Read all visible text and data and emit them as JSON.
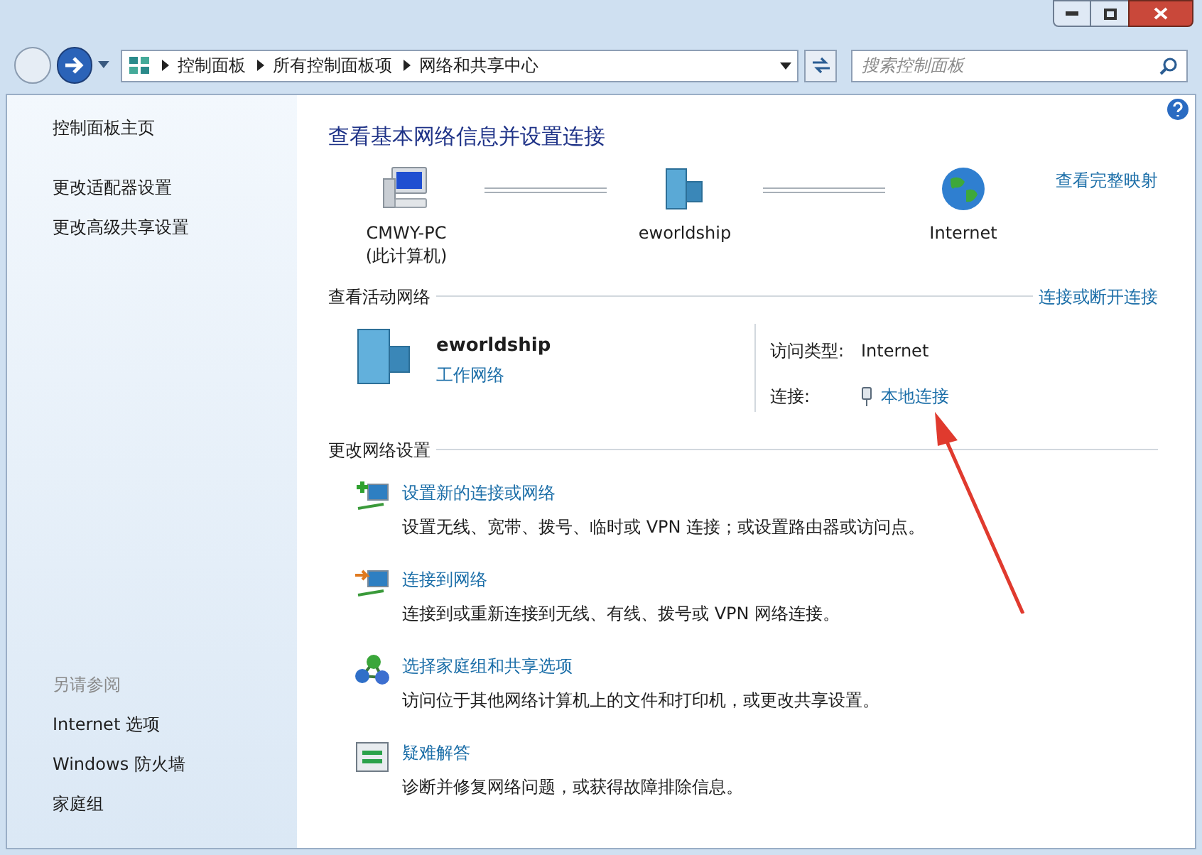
{
  "address_bar": {
    "breadcrumbs": [
      "控制面板",
      "所有控制面板项",
      "网络和共享中心"
    ]
  },
  "search": {
    "placeholder": "搜索控制面板"
  },
  "sidebar": {
    "items": [
      "控制面板主页",
      "更改适配器设置",
      "更改高级共享设置"
    ],
    "see_also_title": "另请参阅",
    "see_also": [
      "Internet 选项",
      "Windows 防火墙",
      "家庭组"
    ]
  },
  "main": {
    "title": "查看基本网络信息并设置连接",
    "full_map_link": "查看完整映射",
    "map_nodes": [
      {
        "kind": "computer",
        "label": "CMWY-PC",
        "sublabel": "(此计算机)"
      },
      {
        "kind": "network",
        "label": "eworldship"
      },
      {
        "kind": "internet",
        "label": "Internet"
      }
    ],
    "active_section": {
      "title": "查看活动网络",
      "link": "连接或断开连接",
      "network_name": "eworldship",
      "network_type": "工作网络",
      "access_label": "访问类型:",
      "access_value": "Internet",
      "connection_label": "连接:",
      "connection_value": "本地连接"
    },
    "change_section": {
      "title": "更改网络设置",
      "tasks": [
        {
          "kind": "new-connection",
          "title": "设置新的连接或网络",
          "description": "设置无线、宽带、拨号、临时或 VPN 连接；或设置路由器或访问点。"
        },
        {
          "kind": "connect",
          "title": "连接到网络",
          "description": "连接到或重新连接到无线、有线、拨号或 VPN 网络连接。"
        },
        {
          "kind": "homegroup",
          "title": "选择家庭组和共享选项",
          "description": "访问位于其他网络计算机上的文件和打印机，或更改共享设置。"
        },
        {
          "kind": "troubleshoot",
          "title": "疑难解答",
          "description": "诊断并修复网络问题，或获得故障排除信息。"
        }
      ]
    }
  }
}
